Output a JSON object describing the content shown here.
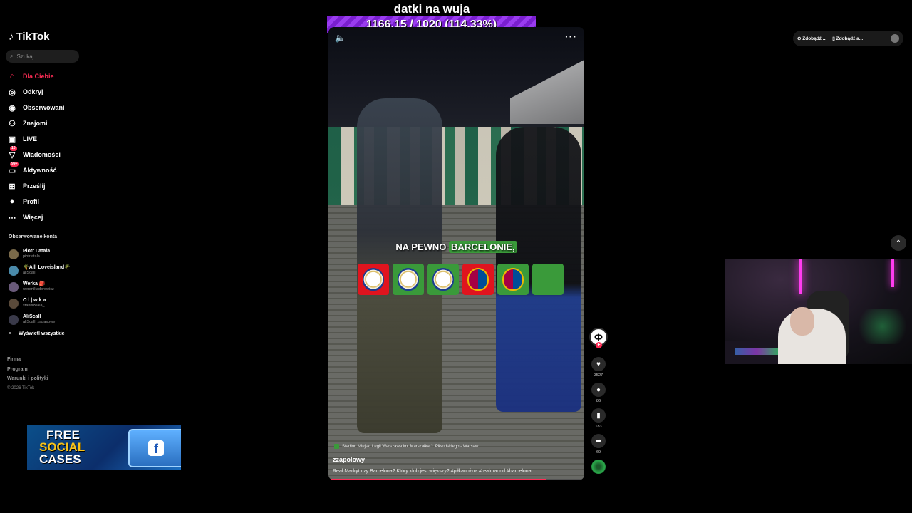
{
  "overlay": {
    "title": "datki na wuja",
    "progress_text": "1166.15 / 1020 (114.33%)"
  },
  "app": {
    "name": "TikTok"
  },
  "search": {
    "placeholder": "Szukaj"
  },
  "nav": [
    {
      "label": "Dla Ciebie",
      "icon": "home-icon",
      "active": true
    },
    {
      "label": "Odkryj",
      "icon": "compass-icon"
    },
    {
      "label": "Obserwowani",
      "icon": "following-avatar-icon"
    },
    {
      "label": "Znajomi",
      "icon": "friends-icon"
    },
    {
      "label": "LIVE",
      "icon": "live-icon"
    },
    {
      "label": "Wiadomości",
      "icon": "messages-icon",
      "badge": "10"
    },
    {
      "label": "Aktywność",
      "icon": "activity-icon",
      "badge": "99+"
    },
    {
      "label": "Prześlij",
      "icon": "upload-icon"
    },
    {
      "label": "Profil",
      "icon": "profile-avatar-icon"
    },
    {
      "label": "Więcej",
      "icon": "more-icon"
    }
  ],
  "followed": {
    "title": "Obserwowane konta",
    "accounts": [
      {
        "name": "Piotr Latała",
        "handle": "piotrlatala"
      },
      {
        "name": "🌴All_Loveisland🌴",
        "handle": "allScall"
      },
      {
        "name": "Werka 🎒",
        "handle": "weronikadorowicz"
      },
      {
        "name": "O l | w k a",
        "handle": "staniszeala_"
      },
      {
        "name": "AliScall",
        "handle": "aliScall_zapasowe_"
      }
    ],
    "show_all": "Wyświetl wszystkie"
  },
  "footer": {
    "links": [
      "Firma",
      "Program",
      "Warunki i polityki"
    ],
    "copyright": "© 2026 TikTok"
  },
  "ad": {
    "line1": "FREE",
    "line2": "SOCIAL",
    "line3": "CASES",
    "fb": "f"
  },
  "video": {
    "caption_prefix": "NA PEWNO",
    "caption_highlight": "BARCELONIE,",
    "location": "Stadion Miejski Legii Warszawa im. Marszałka J. Piłsudskiego - Warsaw",
    "username": "zzapolowy",
    "description": "Real Madryt czy Barcelona? Który klub jest większy? #piłkanożna #realmadrid #barcelona",
    "progress": 0.85,
    "crests": [
      {
        "club": "realmadrid",
        "bg": "#e0141e"
      },
      {
        "club": "realmadrid",
        "bg": "#3a9a3a"
      },
      {
        "club": "realmadrid",
        "bg": "#3a9a3a"
      },
      {
        "club": "barcelona",
        "bg": "#e0141e"
      },
      {
        "club": "barcelona",
        "bg": "#3a9a3a"
      },
      {
        "club": "",
        "bg": "#3a9a3a"
      }
    ]
  },
  "actions": {
    "likes": "3527",
    "comments": "86",
    "saves": "183",
    "shares": "69"
  },
  "topright": {
    "btn1": "Zdobądź ...",
    "btn2": "Zdobądź a..."
  }
}
